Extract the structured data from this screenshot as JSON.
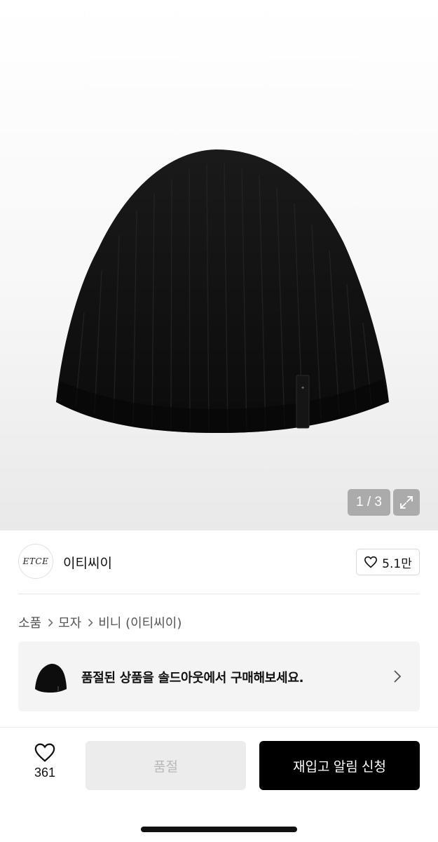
{
  "product_image": {
    "pager": "1 / 3",
    "icon": "expand-icon"
  },
  "brand": {
    "logo_text": "ETCE",
    "name": "이티씨이",
    "likes": "5.1만",
    "icon": "heart-icon"
  },
  "breadcrumb": {
    "items": [
      "소품",
      "모자",
      "비니 (이티씨이)"
    ]
  },
  "soldout_banner": {
    "text": "품절된 상품을 솔드아웃에서 구매해보세요."
  },
  "bottom_bar": {
    "wish_count": "361",
    "soldout_label": "품절",
    "restock_label": "재입고 알림 신청"
  },
  "colors": {
    "primary_button": "#000000",
    "disabled_button": "#ececec",
    "banner_bg": "#f4f4f5"
  }
}
